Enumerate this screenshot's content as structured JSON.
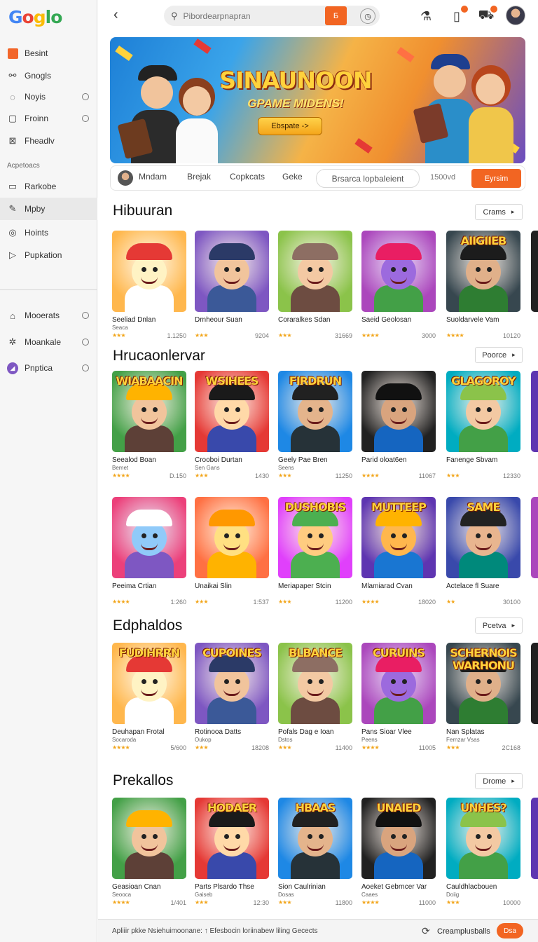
{
  "logo": {
    "letters": [
      "G",
      "o",
      "g",
      "lo"
    ]
  },
  "sidebar": {
    "items_top": [
      {
        "label": "Besint",
        "icon": "orange-square-icon"
      },
      {
        "label": "Gnogls",
        "icon": "link-icon"
      },
      {
        "label": "Noyis",
        "icon": "bubble-icon"
      },
      {
        "label": "Froinn",
        "icon": "square-frame-icon"
      },
      {
        "label": "Fheadlv",
        "icon": "image-icon"
      }
    ],
    "heading": "Acpetoacs",
    "items_mid": [
      {
        "label": "Rarkobe",
        "icon": "window-icon"
      },
      {
        "label": "Mpby",
        "icon": "pen-icon"
      },
      {
        "label": "Hoints",
        "icon": "circle-target-icon"
      },
      {
        "label": "Pupkation",
        "icon": "play-icon"
      }
    ],
    "items_bottom": [
      {
        "label": "Mooerats",
        "icon": "tag-icon"
      },
      {
        "label": "Moankale",
        "icon": "sparkle-icon"
      },
      {
        "label": "Pnptica",
        "icon": "purple-circle-icon"
      }
    ]
  },
  "topbar": {
    "search_placeholder": "Pibordearpnapran",
    "search_button": "Б",
    "icons": [
      "back-icon",
      "search-icon",
      "clock-icon",
      "flask-icon",
      "bookmark-icon",
      "cart-icon",
      "avatar"
    ]
  },
  "hero": {
    "title": "SINAUNOON",
    "subtitle": "GPAME MIDENS!",
    "button": "Ebspate ->"
  },
  "filters": {
    "chips": [
      "Mndam",
      "Brejak",
      "Copkcats",
      "Geke"
    ],
    "pill": "Brsarca lopbaleient",
    "count": "1500vd",
    "button": "Eyrsim"
  },
  "sections": [
    {
      "title": "Hibuuran",
      "button": "Crams",
      "rows": [
        [
          {
            "name": "Seeliad Dnlan",
            "sub": "Seaca",
            "count": "1.1250",
            "rating": 3,
            "thumb_text": ""
          },
          {
            "name": "Drnheour Suan",
            "sub": "",
            "count": "9204",
            "rating": 3,
            "thumb_text": ""
          },
          {
            "name": "Coraralkes Sdan",
            "sub": "",
            "count": "31669",
            "rating": 3,
            "thumb_text": ""
          },
          {
            "name": "Saeid Geolosan",
            "sub": "",
            "count": "3000",
            "rating": 4,
            "thumb_text": ""
          },
          {
            "name": "Suoldarvele Vam",
            "sub": "",
            "count": "10120",
            "rating": 4,
            "thumb_text": "AIIGIIEB"
          }
        ]
      ]
    },
    {
      "title": "Hrucaonlervar",
      "button": "Poorce",
      "rows": [
        [
          {
            "name": "Seealod Boan",
            "sub": "Bemet",
            "count": "D.150",
            "rating": 4,
            "thumb_text": "WIABAACIN"
          },
          {
            "name": "Crooboi Durtan",
            "sub": "Sen Gans",
            "count": "1430",
            "rating": 3,
            "thumb_text": "WSIHEES"
          },
          {
            "name": "Geely Pae Bren",
            "sub": "Seens",
            "count": "11250",
            "rating": 3,
            "thumb_text": "FIRDRUN"
          },
          {
            "name": "Parid oloat6en",
            "sub": "",
            "count": "11067",
            "rating": 4,
            "thumb_text": ""
          },
          {
            "name": "Fanenge Sbvam",
            "sub": "",
            "count": "12330",
            "rating": 3,
            "thumb_text": "GLAGOROY"
          }
        ],
        [
          {
            "name": "Peeima Crtian",
            "sub": "",
            "count": "1:260",
            "rating": 4,
            "thumb_text": ""
          },
          {
            "name": "Unaikai Slin",
            "sub": "",
            "count": "1:537",
            "rating": 3,
            "thumb_text": ""
          },
          {
            "name": "Meriapaper Stcin",
            "sub": "",
            "count": "11200",
            "rating": 3,
            "thumb_text": "DUSHOBIS"
          },
          {
            "name": "Mlamiarad Cvan",
            "sub": "",
            "count": "18020",
            "rating": 4,
            "thumb_text": "MUTTEEP"
          },
          {
            "name": "Actelace fl Suare",
            "sub": "",
            "count": "30100",
            "rating": 2,
            "thumb_text": "SAME"
          }
        ]
      ]
    },
    {
      "title": "Edphaldos",
      "button": "Pcetva",
      "rows": [
        [
          {
            "name": "Deuhapan Frotal",
            "sub": "Socaroda",
            "count": "5/600",
            "rating": 4,
            "thumb_text": "FUDIHRRN"
          },
          {
            "name": "Rotinooa Datts",
            "sub": "Oukop",
            "count": "18208",
            "rating": 3,
            "thumb_text": "CUPOINES"
          },
          {
            "name": "Pofals Dag e Ioan",
            "sub": "Dstos",
            "count": "11400",
            "rating": 3,
            "thumb_text": "BLBANCE"
          },
          {
            "name": "Pans Sioar Vlee",
            "sub": "Peens",
            "count": "11005",
            "rating": 4,
            "thumb_text": "CURUINS"
          },
          {
            "name": "Nan Splatas",
            "sub": "Fernzar Vsas",
            "count": "2C168",
            "rating": 3,
            "thumb_text": "SCHERNOIS WARHONU"
          }
        ]
      ]
    },
    {
      "title": "Prekallos",
      "button": "Drome",
      "rows": [
        [
          {
            "name": "Geasioan Cnan",
            "sub": "Seooca",
            "count": "1/401",
            "rating": 4,
            "thumb_text": ""
          },
          {
            "name": "Parts Plsardo Thse",
            "sub": "Gaiseb",
            "count": "12:30",
            "rating": 3,
            "thumb_text": "HODAER"
          },
          {
            "name": "Sion Caulrinian",
            "sub": "Dosas",
            "count": "11800",
            "rating": 3,
            "thumb_text": "HBAAS"
          },
          {
            "name": "Aoeket Gebrncer Var",
            "sub": "Caaes",
            "count": "11000",
            "rating": 4,
            "thumb_text": "UNAIED"
          },
          {
            "name": "Cauldhlacbouen",
            "sub": "Doiig",
            "count": "10000",
            "rating": 3,
            "thumb_text": "UNHES?"
          }
        ]
      ]
    }
  ],
  "bottombar": {
    "text": "Apliiir pkke Nsiehuimoonane:  ↑  Efesbocin loriinabew liling Gecects",
    "link": "Creamplusballs",
    "button": "Dsa"
  },
  "colors": {
    "accent": "#f26522",
    "star": "#f2a51a",
    "sidebar_bg": "#f6f6f6"
  }
}
